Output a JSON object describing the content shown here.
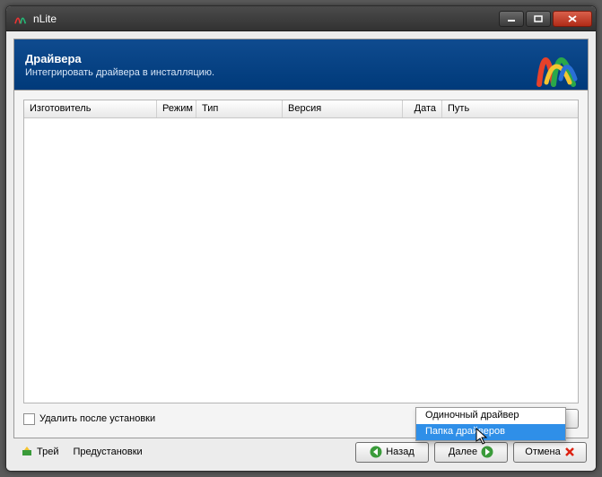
{
  "window": {
    "title": "nLite"
  },
  "banner": {
    "title": "Драйвера",
    "subtitle": "Интегрировать драйвера в инсталляцию."
  },
  "table": {
    "columns": {
      "manufacturer": "Изготовитель",
      "mode": "Режим",
      "type": "Тип",
      "version": "Версия",
      "date": "Дата",
      "path": "Путь"
    }
  },
  "options": {
    "delete_after_install": "Удалить после установки"
  },
  "popup": {
    "single_driver": "Одиночный драйвер",
    "driver_folder": "Папка драйверов"
  },
  "footer": {
    "tray": "Трей",
    "presets": "Предустановки",
    "back": "Назад",
    "next": "Далее",
    "cancel": "Отмена"
  }
}
